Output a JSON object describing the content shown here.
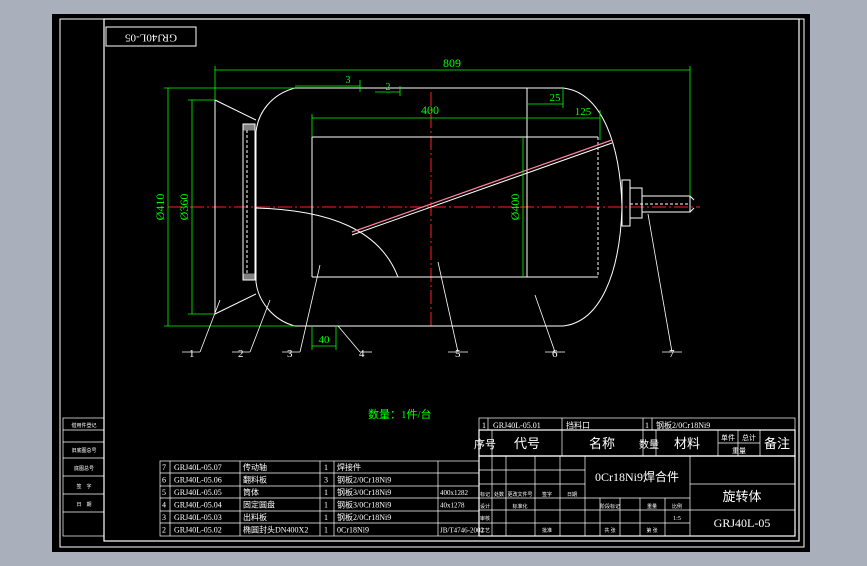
{
  "colors": {
    "bg_outer": "#aab0bb",
    "canvas": "#000000",
    "line": "#ffffff",
    "dim": "#00ff00",
    "center": "#ff2020",
    "pink": "#ff80a0",
    "cyan": "#00c8ff"
  },
  "stamp": "GRJ40L-05",
  "dims": {
    "overall": "809",
    "top_a": "3",
    "top_b": "2",
    "inner": "400",
    "d25": "25",
    "d125": "125",
    "d410": "Ø410",
    "d360": "Ø360",
    "d400": "Ø400",
    "d40": "40"
  },
  "balloons": [
    "1",
    "2",
    "3",
    "4",
    "5",
    "6",
    "7"
  ],
  "quantity_note": "数量：1件/台",
  "bom_top": {
    "no": "1",
    "code": "GRJ40L-05.01",
    "name": "挡料口",
    "qty": "1",
    "material": "钢板2/0Cr18Ni9"
  },
  "bom_header": {
    "no": "序号",
    "code": "代号",
    "name": "名称",
    "qty": "数量",
    "material": "材料",
    "single": "单件",
    "total": "总计",
    "weight": "重量",
    "remark": "备注"
  },
  "bom_rows": [
    {
      "no": "7",
      "code": "GRJ40L-05.07",
      "name": "传动轴",
      "qty": "1",
      "material": "焊接件",
      "remark": ""
    },
    {
      "no": "6",
      "code": "GRJ40L-05.06",
      "name": "翻料板",
      "qty": "3",
      "material": "钢板2/0Cr18Ni9",
      "remark": ""
    },
    {
      "no": "5",
      "code": "GRJ40L-05.05",
      "name": "筒体",
      "qty": "1",
      "material": "钢板3/0Cr18Ni9",
      "remark": "400x1282"
    },
    {
      "no": "4",
      "code": "GRJ40L-05.04",
      "name": "固定圆盘",
      "qty": "1",
      "material": "钢板3/0Cr18Ni9",
      "remark": "40x1278"
    },
    {
      "no": "3",
      "code": "GRJ40L-05.03",
      "name": "出料板",
      "qty": "1",
      "material": "钢板2/0Cr18Ni9",
      "remark": ""
    },
    {
      "no": "2",
      "code": "GRJ40L-05.02",
      "name": "椭圆封头DN400X2",
      "qty": "1",
      "material": "0Cr18Ni9",
      "remark": "JB/T4746-2002"
    }
  ],
  "title_block": {
    "material": "0Cr18Ni9焊合件",
    "name": "旋转体",
    "drawing_no": "GRJ40L-05",
    "scale": "1:5"
  },
  "left_strip": [
    "借用件登记",
    "旧底图总号",
    "底图总号",
    "签　字",
    "日　期"
  ],
  "sign_labels": [
    "标记",
    "处数",
    "更改文件号",
    "签字",
    "日期",
    "设计",
    "标准化",
    "审核",
    "工艺",
    "批准",
    "阶段标记",
    "重量",
    "比例",
    "共 张",
    "第 张"
  ]
}
